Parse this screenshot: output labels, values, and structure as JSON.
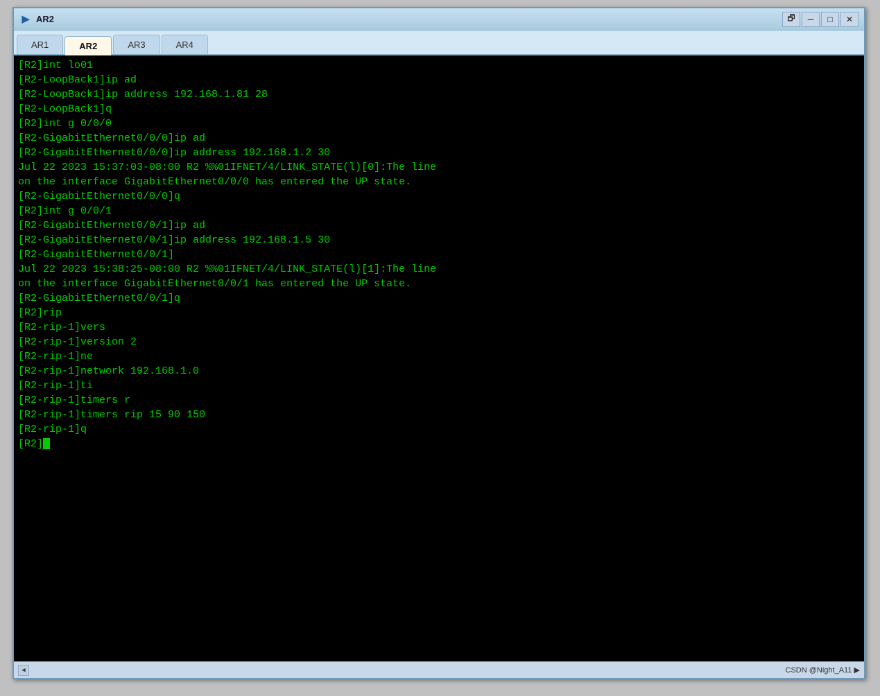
{
  "window": {
    "title": "AR2",
    "icon": "▶"
  },
  "titlebar": {
    "restore_label": "🗗",
    "minimize_label": "─",
    "maximize_label": "□",
    "close_label": "✕"
  },
  "tabs": [
    {
      "label": "AR1",
      "active": false
    },
    {
      "label": "AR2",
      "active": true
    },
    {
      "label": "AR3",
      "active": false
    },
    {
      "label": "AR4",
      "active": false
    }
  ],
  "terminal": {
    "lines": [
      "[R2]int lo01",
      "[R2-LoopBack1]ip ad",
      "[R2-LoopBack1]ip address 192.168.1.81 28",
      "[R2-LoopBack1]q",
      "[R2]int g 0/0/0",
      "[R2-GigabitEthernet0/0/0]ip ad",
      "[R2-GigabitEthernet0/0/0]ip address 192.168.1.2 30",
      "Jul 22 2023 15:37:03-08:00 R2 %%01IFNET/4/LINK_STATE(l)[0]:The line",
      "on the interface GigabitEthernet0/0/0 has entered the UP state.",
      "[R2-GigabitEthernet0/0/0]q",
      "[R2]int g 0/0/1",
      "[R2-GigabitEthernet0/0/1]ip ad",
      "[R2-GigabitEthernet0/0/1]ip address 192.168.1.5 30",
      "[R2-GigabitEthernet0/0/1]",
      "Jul 22 2023 15:38:25-08:00 R2 %%01IFNET/4/LINK_STATE(l)[1]:The line",
      "on the interface GigabitEthernet0/0/1 has entered the UP state.",
      "[R2-GigabitEthernet0/0/1]q",
      "[R2]rip",
      "[R2-rip-1]vers",
      "[R2-rip-1]version 2",
      "[R2-rip-1]ne",
      "[R2-rip-1]network 192.168.1.0",
      "[R2-rip-1]ti",
      "[R2-rip-1]timers r",
      "[R2-rip-1]timers rip 15 90 150",
      "[R2-rip-1]q",
      "[R2]"
    ]
  },
  "statusbar": {
    "right_text": "CSDN @Night_A11 ▶"
  }
}
